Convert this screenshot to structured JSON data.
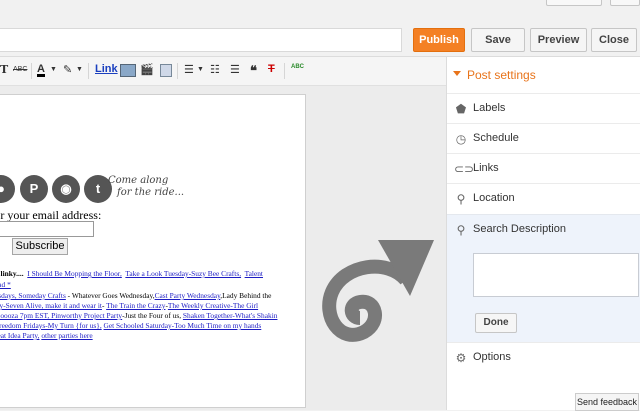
{
  "header": {
    "publish": "Publish",
    "save": "Save",
    "preview": "Preview",
    "close": "Close"
  },
  "toolbar": {
    "font_size_icon": "T",
    "strike_label": "ABC",
    "text_color_icon": "A",
    "highlight_icon": "pencil-icon",
    "link_label": "Link",
    "spell_label": "ABC",
    "clear_format_icon": "T"
  },
  "post": {
    "script_line1": "Come along",
    "script_line2": "for the ride...",
    "email_label": "er your email address:",
    "subscribe": "Subscribe",
    "linky_lines": [
      {
        "bold": "o linky....",
        "links": [
          "I Should Be Mopping the Floor,",
          "Take a Look Tuesday-Suzy Bee Crafts,",
          "Talent"
        ]
      },
      {
        "bold": "",
        "links": [
          "ead *"
        ]
      },
      {
        "bold": "",
        "links": [
          "esdays, Someday Crafts"
        ],
        "text": " - Whatever Goes Wednesday,",
        "links2": [
          "Cast Party Wednesday"
        ],
        "text2": ",Lady Behind the"
      },
      {
        "bold": "",
        "links": [
          "rty-Seven Alive, make it and wear it"
        ],
        "text": "- ",
        "links2": [
          "The Train the Crazy",
          "The Weekly Creative-The Girl"
        ]
      },
      {
        "bold": "",
        "links": [
          "aloooza 7pm EST, Pinworthy Project Party"
        ],
        "text": "-Just the Four of us, ",
        "links2": [
          "Shaken Together-What's Shakin"
        ]
      },
      {
        "bold": "",
        "links": [
          "Freedom Fridays-My Turn {for us},",
          "Get Schooled Saturday-Too Much Time on my hands"
        ]
      },
      {
        "bold": "",
        "links": [
          "reat Idea Party,"
        ],
        "text": " ",
        "links2": [
          "other parties here"
        ]
      }
    ]
  },
  "sidebar": {
    "title": "Post settings",
    "items": [
      {
        "label": "Labels",
        "icon": "tag-icon"
      },
      {
        "label": "Schedule",
        "icon": "clock-icon"
      },
      {
        "label": "Links",
        "icon": "link-icon"
      },
      {
        "label": "Location",
        "icon": "pin-icon"
      },
      {
        "label": "Search Description",
        "icon": "search-icon"
      },
      {
        "label": "Options",
        "icon": "gear-icon"
      }
    ],
    "done": "Done"
  },
  "feedback": "Send feedback",
  "colors": {
    "accent": "#f48024",
    "arrow": "#7a7a7a"
  }
}
